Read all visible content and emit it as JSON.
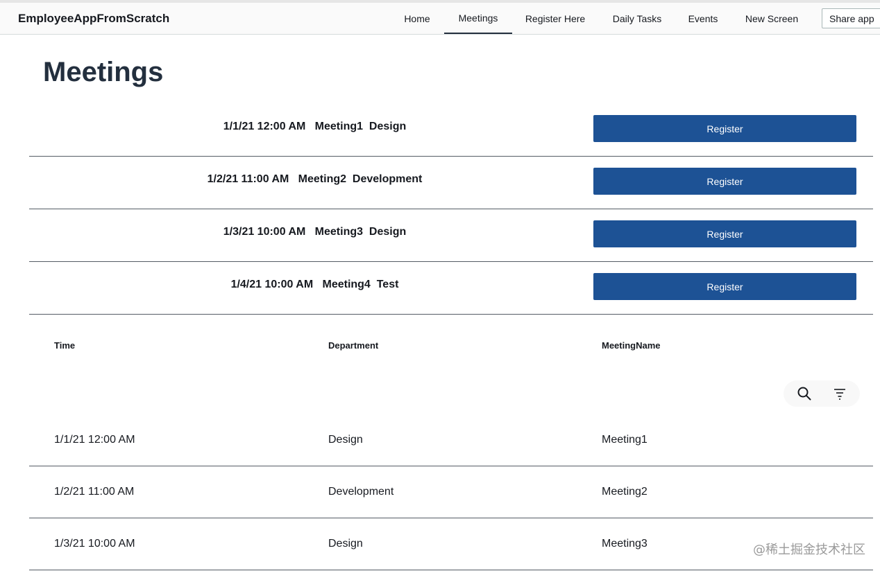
{
  "app": {
    "title": "EmployeeAppFromScratch"
  },
  "nav": {
    "tabs": [
      {
        "label": "Home"
      },
      {
        "label": "Meetings",
        "active": true
      },
      {
        "label": "Register Here"
      },
      {
        "label": "Daily Tasks"
      },
      {
        "label": "Events"
      },
      {
        "label": "New Screen"
      }
    ],
    "share_label": "Share app"
  },
  "page": {
    "title": "Meetings"
  },
  "meetings": [
    {
      "summary": "1/1/21 12:00 AM   Meeting1  Design",
      "button": "Register"
    },
    {
      "summary": "1/2/21 11:00 AM   Meeting2  Development",
      "button": "Register"
    },
    {
      "summary": "1/3/21 10:00 AM   Meeting3  Design",
      "button": "Register"
    },
    {
      "summary": "1/4/21 10:00 AM   Meeting4  Test",
      "button": "Register"
    }
  ],
  "table": {
    "columns": [
      "Time",
      "Department",
      "MeetingName"
    ],
    "rows": [
      [
        "1/1/21 12:00 AM",
        "Design",
        "Meeting1"
      ],
      [
        "1/2/21 11:00 AM",
        "Development",
        "Meeting2"
      ],
      [
        "1/3/21 10:00 AM",
        "Design",
        "Meeting3"
      ]
    ],
    "tools": [
      "search-icon",
      "filter-icon"
    ]
  },
  "watermark": "@稀土掘金技术社区",
  "colors": {
    "accent": "#1d5295",
    "text": "#232f3e",
    "divider": "#545b64"
  }
}
